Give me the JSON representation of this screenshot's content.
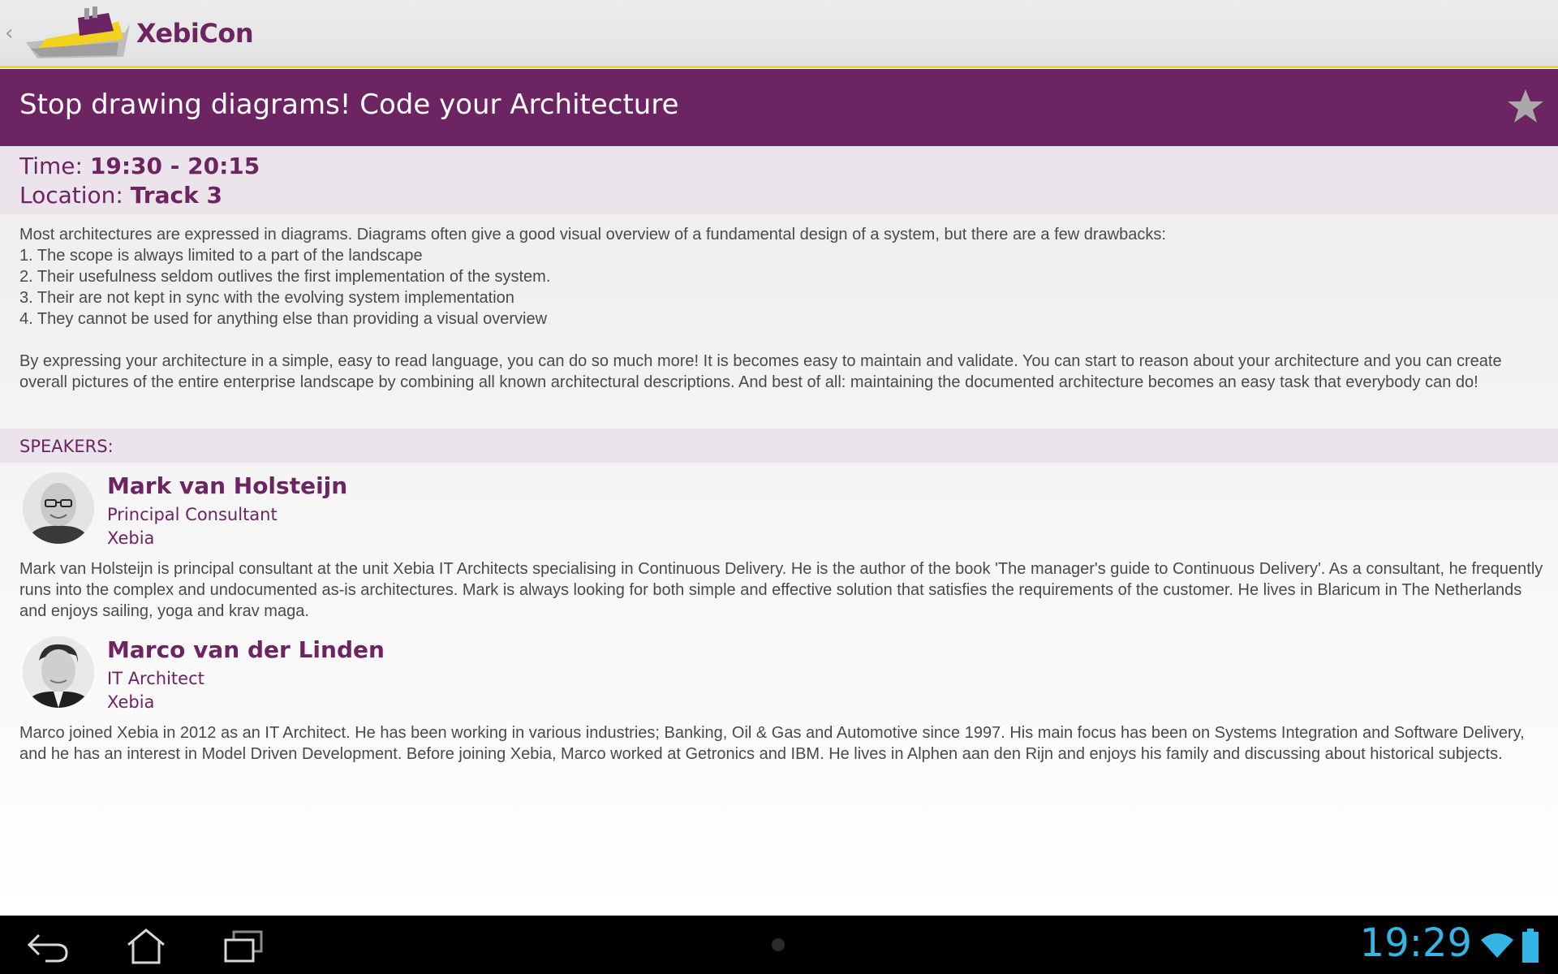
{
  "app": {
    "title": "XebiCon"
  },
  "session": {
    "title": "Stop drawing diagrams! Code your Architecture",
    "time_label": "Time: ",
    "time_value": "19:30 - 20:15",
    "location_label": "Location: ",
    "location_value": "Track 3",
    "abstract_lines": [
      "Most architectures are expressed in diagrams. Diagrams often give a good visual overview of a fundamental design of a system, but there are a few drawbacks:",
      "1. The scope is always limited to a part of the landscape",
      "2. Their usefulness seldom outlives the first implementation of the system.",
      "3. Their are not kept in sync with the evolving system implementation",
      "4. They cannot be used for anything else than providing a visual overview"
    ],
    "abstract_paragraph": "By expressing your architecture in a simple, easy to read language, you can do so much more! It is becomes easy to maintain and validate. You can start to reason about your architecture and you can create overall pictures of the entire enterprise landscape by combining all known architectural descriptions. And best of all: maintaining the documented architecture becomes an easy task that everybody can do!"
  },
  "speakers_header": "SPEAKERS:",
  "speakers": [
    {
      "name": "Mark van Holsteijn",
      "role": "Principal Consultant",
      "company": "Xebia",
      "bio": "Mark van Holsteijn is principal consultant at the unit Xebia IT Architects specialising in Continuous Delivery. He is the author of the book 'The manager's guide to Continuous Delivery'. As a consultant, he frequently runs into the complex and undocumented as-is architectures. Mark is always looking for both simple and effective solution that satisfies the requirements of the customer. He lives in Blaricum in The Netherlands and enjoys sailing, yoga and krav maga."
    },
    {
      "name": "Marco van der Linden",
      "role": "IT Architect",
      "company": "Xebia",
      "bio": "Marco joined Xebia in 2012 as an IT Architect. He has been working in various industries; Banking, Oil & Gas and Automotive since 1997. His main focus has been on Systems Integration and Software Delivery, and he has an interest in Model Driven Development. Before joining Xebia, Marco worked at Getronics and IBM. He lives in Alphen aan den Rijn and enjoys his family and discussing about historical subjects."
    }
  ],
  "status": {
    "clock": "19:29"
  },
  "icons": {
    "up": "chevron-left-icon",
    "logo": "ship-logo-icon",
    "favorite": "star-icon",
    "back": "back-icon",
    "home": "home-icon",
    "recents": "recent-apps-icon",
    "wifi": "wifi-icon",
    "battery": "battery-icon"
  },
  "colors": {
    "brand_purple": "#6d2462",
    "accent_yellow": "#f2d21d",
    "section_tint": "#ebe4ea",
    "clock_blue": "#33b5e5"
  }
}
